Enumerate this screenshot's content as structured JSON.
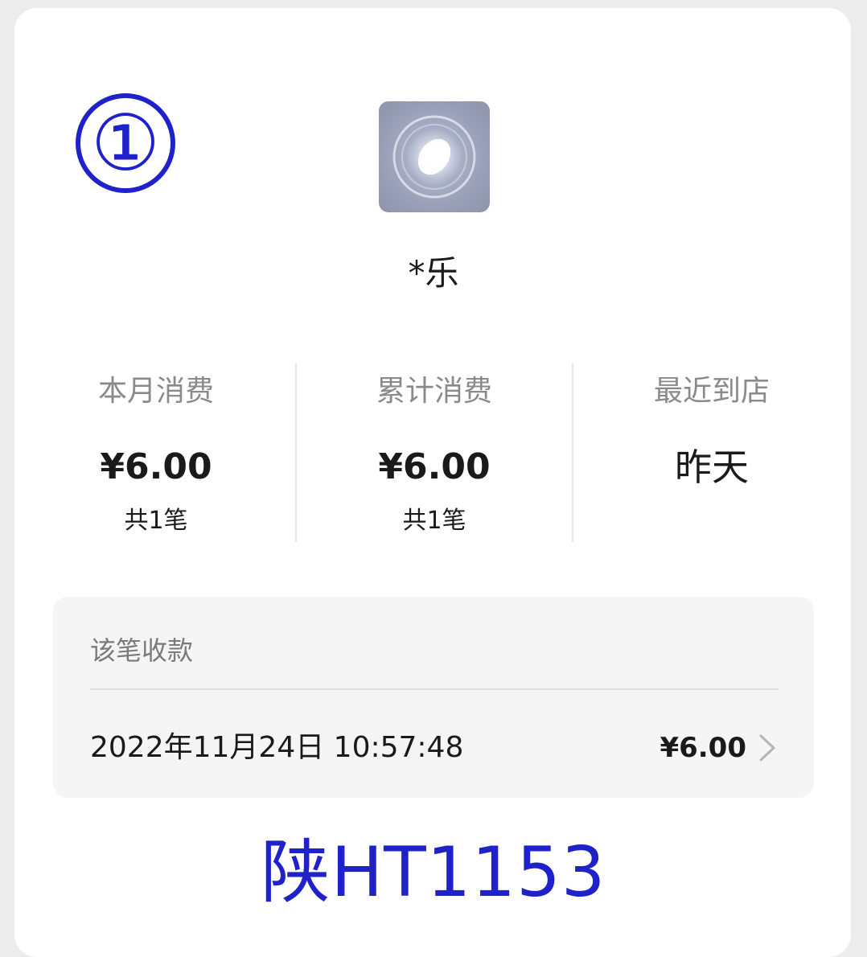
{
  "annotation": {
    "marker": "①",
    "plate": "陕HT1153",
    "color": "#1f22c8"
  },
  "merchant": {
    "avatar_icon": "glowing-orb-avatar",
    "name": "*乐"
  },
  "stats": [
    {
      "label": "本月消费",
      "value": "¥6.00",
      "sub": "共1笔"
    },
    {
      "label": "累计消费",
      "value": "¥6.00",
      "sub": "共1笔"
    },
    {
      "label": "最近到店",
      "value": "昨天"
    }
  ],
  "payment": {
    "title": "该笔收款",
    "datetime": "2022年11月24日 10:57:48",
    "amount": "¥6.00",
    "chevron_icon": "chevron-right-icon"
  }
}
